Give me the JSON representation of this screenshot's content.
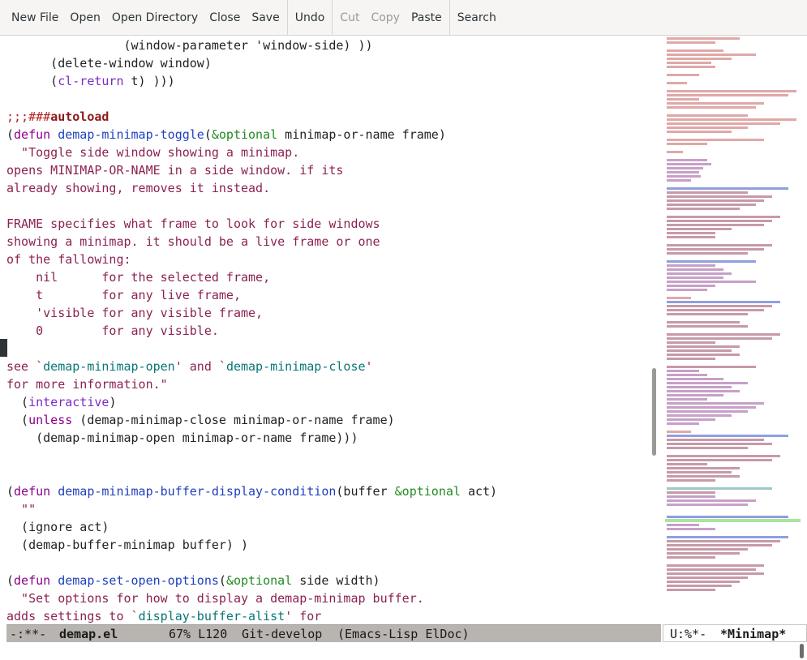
{
  "toolbar": {
    "new_file": "New File",
    "open": "Open",
    "open_directory": "Open Directory",
    "close": "Close",
    "save": "Save",
    "undo": "Undo",
    "cut": "Cut",
    "copy": "Copy",
    "paste": "Paste",
    "search": "Search"
  },
  "editor": {
    "lines": [
      {
        "segs": [
          {
            "t": "                (window-parameter 'window-side) ))",
            "c": ""
          }
        ]
      },
      {
        "segs": [
          {
            "t": "      (delete-window window)",
            "c": ""
          }
        ]
      },
      {
        "segs": [
          {
            "t": "      (",
            "c": ""
          },
          {
            "t": "cl-return",
            "c": "bu"
          },
          {
            "t": " t) )))",
            "c": ""
          }
        ]
      },
      {
        "segs": [
          {
            "t": "",
            "c": ""
          }
        ]
      },
      {
        "segs": [
          {
            "t": ";;;###",
            "c": "cm"
          },
          {
            "t": "autoload",
            "c": "ac"
          }
        ]
      },
      {
        "segs": [
          {
            "t": "(",
            "c": ""
          },
          {
            "t": "defun",
            "c": "kw"
          },
          {
            "t": " ",
            "c": ""
          },
          {
            "t": "demap-minimap-toggle",
            "c": "fn"
          },
          {
            "t": "(",
            "c": ""
          },
          {
            "t": "&optional",
            "c": "ty"
          },
          {
            "t": " minimap-or-name frame)",
            "c": ""
          }
        ]
      },
      {
        "segs": [
          {
            "t": "  \"Toggle side window showing a minimap.",
            "c": "ds"
          }
        ]
      },
      {
        "segs": [
          {
            "t": "opens MINIMAP-OR-NAME in a side window. if its",
            "c": "ds"
          }
        ]
      },
      {
        "segs": [
          {
            "t": "already showing, removes it instead.",
            "c": "ds"
          }
        ]
      },
      {
        "segs": [
          {
            "t": "",
            "c": ""
          }
        ]
      },
      {
        "segs": [
          {
            "t": "FRAME specifies what frame to look for side windows",
            "c": "ds"
          }
        ]
      },
      {
        "segs": [
          {
            "t": "showing a minimap. it should be a live frame or one",
            "c": "ds"
          }
        ]
      },
      {
        "segs": [
          {
            "t": "of the fallowing:",
            "c": "ds"
          }
        ]
      },
      {
        "segs": [
          {
            "t": "    nil      for the selected frame,",
            "c": "ds"
          }
        ]
      },
      {
        "segs": [
          {
            "t": "    t        for any live frame,",
            "c": "ds"
          }
        ]
      },
      {
        "segs": [
          {
            "t": "    'visible for any visible frame,",
            "c": "ds"
          }
        ]
      },
      {
        "segs": [
          {
            "t": "    0        for any visible.",
            "c": "ds"
          }
        ]
      },
      {
        "segs": [
          {
            "t": "",
            "c": ""
          }
        ]
      },
      {
        "segs": [
          {
            "t": "see `",
            "c": "ds"
          },
          {
            "t": "demap-minimap-open",
            "c": "dq"
          },
          {
            "t": "' and `",
            "c": "ds"
          },
          {
            "t": "demap-minimap-close",
            "c": "dq"
          },
          {
            "t": "'",
            "c": "ds"
          }
        ]
      },
      {
        "segs": [
          {
            "t": "for more information.\"",
            "c": "ds"
          }
        ]
      },
      {
        "segs": [
          {
            "t": "  (",
            "c": ""
          },
          {
            "t": "interactive",
            "c": "bu"
          },
          {
            "t": ")",
            "c": ""
          }
        ]
      },
      {
        "segs": [
          {
            "t": "  (",
            "c": ""
          },
          {
            "t": "unless",
            "c": "kw"
          },
          {
            "t": " (demap-minimap-close minimap-or-name frame)",
            "c": ""
          }
        ]
      },
      {
        "segs": [
          {
            "t": "    (demap-minimap-open minimap-or-name frame)))",
            "c": ""
          }
        ]
      },
      {
        "segs": [
          {
            "t": "",
            "c": ""
          }
        ]
      },
      {
        "segs": [
          {
            "t": "",
            "c": ""
          }
        ]
      },
      {
        "segs": [
          {
            "t": "(",
            "c": ""
          },
          {
            "t": "defun",
            "c": "kw"
          },
          {
            "t": " ",
            "c": ""
          },
          {
            "t": "demap-minimap-buffer-display-condition",
            "c": "fn"
          },
          {
            "t": "(buffer ",
            "c": ""
          },
          {
            "t": "&optional",
            "c": "ty"
          },
          {
            "t": " act)",
            "c": ""
          }
        ]
      },
      {
        "segs": [
          {
            "t": "  \"\"",
            "c": "ds"
          }
        ]
      },
      {
        "segs": [
          {
            "t": "  (ignore act)",
            "c": ""
          }
        ]
      },
      {
        "segs": [
          {
            "t": "  (demap-buffer-minimap buffer) )",
            "c": ""
          }
        ]
      },
      {
        "segs": [
          {
            "t": "",
            "c": ""
          }
        ]
      },
      {
        "segs": [
          {
            "t": "(",
            "c": ""
          },
          {
            "t": "defun",
            "c": "kw"
          },
          {
            "t": " ",
            "c": ""
          },
          {
            "t": "demap-set-open-options",
            "c": "fn"
          },
          {
            "t": "(",
            "c": ""
          },
          {
            "t": "&optional",
            "c": "ty"
          },
          {
            "t": " side width)",
            "c": ""
          }
        ]
      },
      {
        "segs": [
          {
            "t": "  \"Set options for how to display a demap-minimap buffer.",
            "c": "ds"
          }
        ]
      },
      {
        "segs": [
          {
            "t": "adds settings to `",
            "c": "ds"
          },
          {
            "t": "display-buffer-alist",
            "c": "dq"
          },
          {
            "t": "' for",
            "c": "ds"
          }
        ]
      }
    ]
  },
  "modeline": {
    "status": "-:**-",
    "buffer_name": "demap.el",
    "position": "67% L120",
    "vc": "Git-develop",
    "modes": "(Emacs-Lisp ElDoc)"
  },
  "minimap_modeline": {
    "status": "U:%*-",
    "buffer_name": "*Minimap*"
  }
}
